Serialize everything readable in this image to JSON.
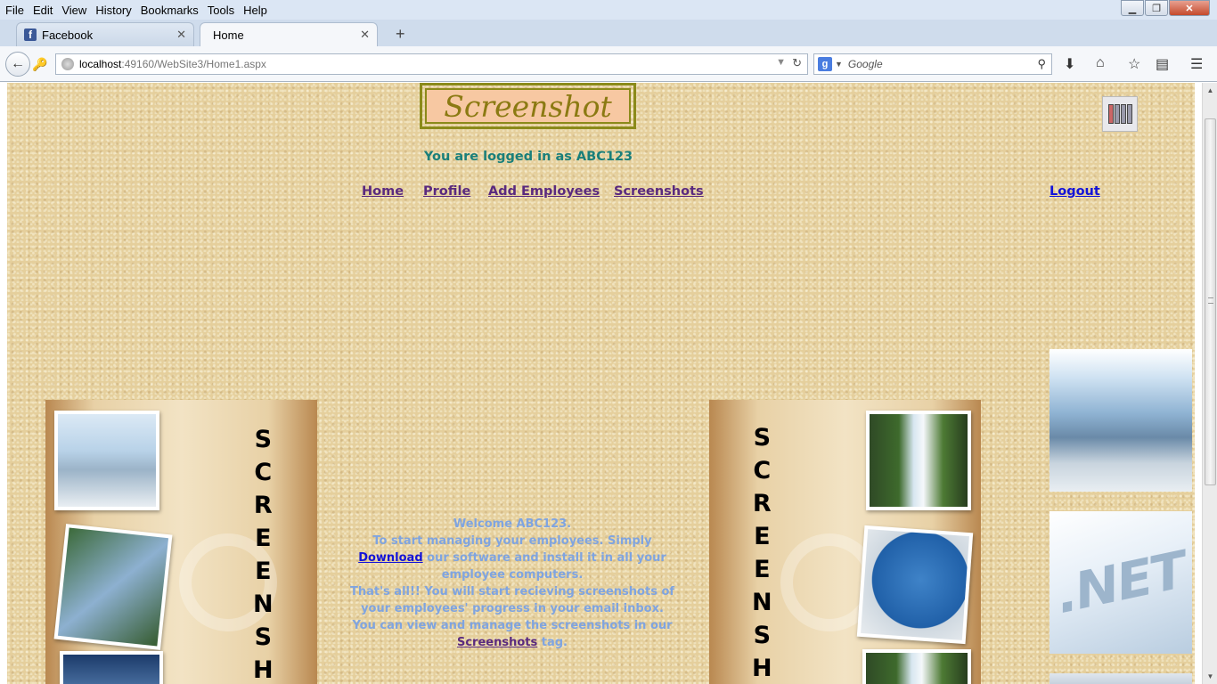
{
  "menubar": {
    "items": [
      "File",
      "Edit",
      "View",
      "History",
      "Bookmarks",
      "Tools",
      "Help"
    ]
  },
  "window_controls": {
    "minimize": "▁",
    "maximize": "❐",
    "close": "✕"
  },
  "tabs": [
    {
      "label": "Facebook",
      "icon": "facebook-icon",
      "active": false
    },
    {
      "label": "Home",
      "active": true
    }
  ],
  "new_tab_label": "+",
  "addressbar": {
    "host": "localhost",
    "path": ":49160/WebSite3/Home1.aspx"
  },
  "searchbar": {
    "placeholder": "Google",
    "engine_letter": "g"
  },
  "page": {
    "logo_text": "Screenshot",
    "logged_in_text": "You are logged in as ABC123",
    "nav": {
      "home": "Home",
      "profile": "Profile",
      "add_employees": "Add Employees",
      "screenshots": "Screenshots",
      "logout": "Logout"
    },
    "vertical_text": [
      "S",
      "C",
      "R",
      "E",
      "E",
      "N",
      "S",
      "H"
    ],
    "welcome": {
      "line1": "Welcome ABC123.",
      "line2_pre": "To start managing your employees. Simply ",
      "download_link": "Download",
      "line2_post": " our software and install it in all your employee computers.",
      "line3": "That's all!! You will start recieving screenshots of your employees' progress in your email inbox.",
      "line4": "You can view and manage the screenshots in our ",
      "screenshots_link": "Screenshots",
      "line4_post": "   tag."
    },
    "side_image_text": ".NET"
  },
  "colors": {
    "page_bg": "#e5cf9c",
    "logo_text": "#8b7a12",
    "logo_bg": "#f7c8a2",
    "logged_in": "#1a7f7a",
    "nav_link": "#5a2a7e",
    "logout_link": "#1414d8",
    "welcome_text": "#7fa4e0"
  }
}
